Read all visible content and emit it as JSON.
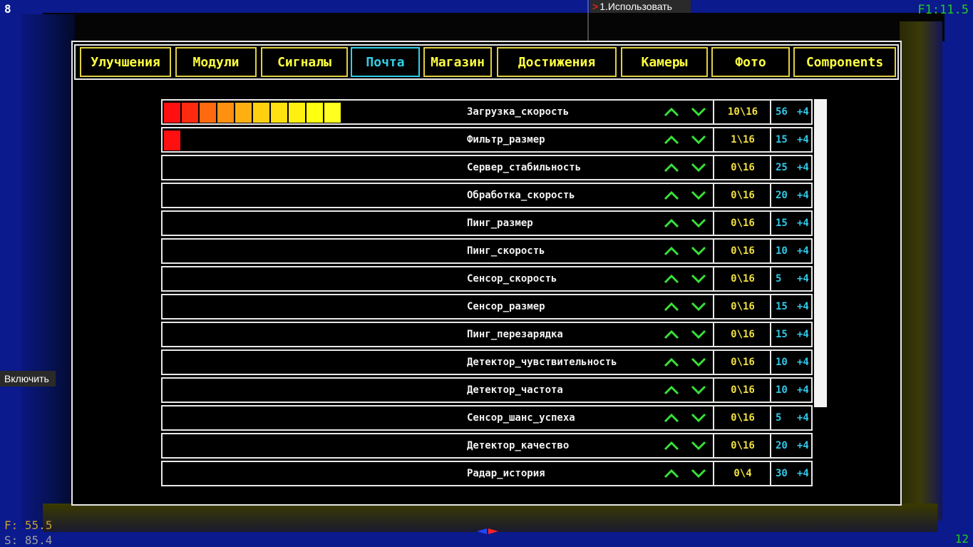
{
  "hud": {
    "top_left": "8",
    "top_right": "F1:11.5",
    "bottom_right": "12",
    "f_value": "F: 55.5",
    "s_value": "S: 85.4",
    "use_prompt": "1.Использовать",
    "enable_prompt": "Включить"
  },
  "tabs": [
    {
      "label": "Улучшения",
      "active": false
    },
    {
      "label": "Модули",
      "active": false
    },
    {
      "label": "Сигналы",
      "active": false
    },
    {
      "label": "Почта",
      "active": true
    },
    {
      "label": "Магазин",
      "active": false
    },
    {
      "label": "Достижения",
      "active": false
    },
    {
      "label": "Камеры",
      "active": false
    },
    {
      "label": "Фото",
      "active": false
    },
    {
      "label": "Components",
      "active": false
    }
  ],
  "colors": {
    "tab_border": "#e0d040",
    "tab_active": "#30d0e8",
    "level_text": "#f0e040",
    "cost_text": "#30c8e8",
    "arrow": "#38e038",
    "level_segment_colors": [
      "#ff1010",
      "#ff2a10",
      "#ff6a10",
      "#ff9010",
      "#ffb010",
      "#ffd010",
      "#ffe010",
      "#fff010",
      "#ffff10",
      "#ffff20"
    ]
  },
  "upgrades": [
    {
      "name": "Загрузка_скорость",
      "level": "10\\16",
      "cost": "56",
      "bonus": "+4",
      "filled": 10
    },
    {
      "name": "Фильтр_размер",
      "level": "1\\16",
      "cost": "15",
      "bonus": "+4",
      "filled": 1
    },
    {
      "name": "Сервер_стабильность",
      "level": "0\\16",
      "cost": "25",
      "bonus": "+4",
      "filled": 0
    },
    {
      "name": "Обработка_скорость",
      "level": "0\\16",
      "cost": "20",
      "bonus": "+4",
      "filled": 0
    },
    {
      "name": "Пинг_размер",
      "level": "0\\16",
      "cost": "15",
      "bonus": "+4",
      "filled": 0
    },
    {
      "name": "Пинг_скорость",
      "level": "0\\16",
      "cost": "10",
      "bonus": "+4",
      "filled": 0
    },
    {
      "name": "Сенсор_скорость",
      "level": "0\\16",
      "cost": "5",
      "bonus": "+4",
      "filled": 0
    },
    {
      "name": "Сенсор_размер",
      "level": "0\\16",
      "cost": "15",
      "bonus": "+4",
      "filled": 0
    },
    {
      "name": "Пинг_перезарядка",
      "level": "0\\16",
      "cost": "15",
      "bonus": "+4",
      "filled": 0
    },
    {
      "name": "Детектор_чувствительность",
      "level": "0\\16",
      "cost": "10",
      "bonus": "+4",
      "filled": 0
    },
    {
      "name": "Детектор_частота",
      "level": "0\\16",
      "cost": "10",
      "bonus": "+4",
      "filled": 0
    },
    {
      "name": "Сенсор_шанс_успеха",
      "level": "0\\16",
      "cost": "5",
      "bonus": "+4",
      "filled": 0
    },
    {
      "name": "Детектор_качество",
      "level": "0\\16",
      "cost": "20",
      "bonus": "+4",
      "filled": 0
    },
    {
      "name": "Радар_история",
      "level": "0\\4",
      "cost": "30",
      "bonus": "+4",
      "filled": 0
    }
  ]
}
